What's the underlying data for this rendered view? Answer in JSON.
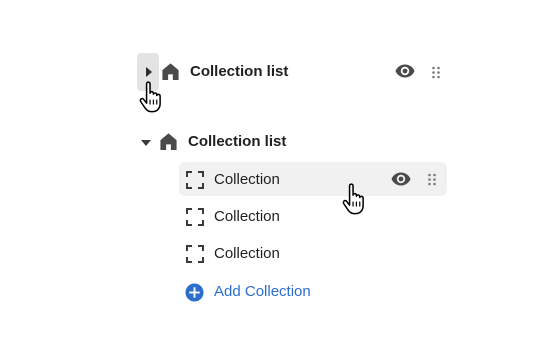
{
  "app": {
    "title": ""
  },
  "collapsed_section": {
    "title": "Collection list",
    "expand_control": "caret-right-icon",
    "section_icon": "house-icon",
    "visibility_icon": "eye-icon",
    "drag_icon": "drag-handle-icon"
  },
  "expanded_section": {
    "title": "Collection list",
    "collapse_control": "caret-down-icon",
    "section_icon": "house-icon",
    "blocks": [
      {
        "label": "Collection",
        "icon": "dashed-square-icon",
        "hovered": true
      },
      {
        "label": "Collection",
        "icon": "dashed-square-icon",
        "hovered": false
      },
      {
        "label": "Collection",
        "icon": "dashed-square-icon",
        "hovered": false
      }
    ],
    "add_block": {
      "label": "Add Collection",
      "icon": "plus-circle-icon"
    }
  },
  "colors": {
    "accent": "#2c6ecb",
    "text": "#1f1f1f",
    "icon": "#4a4a4a",
    "hover_bg": "#f1f1f1",
    "toggle_bg": "#e3e3e3"
  },
  "cursors": [
    "hand-pointer-cursor",
    "hand-pointer-cursor"
  ]
}
